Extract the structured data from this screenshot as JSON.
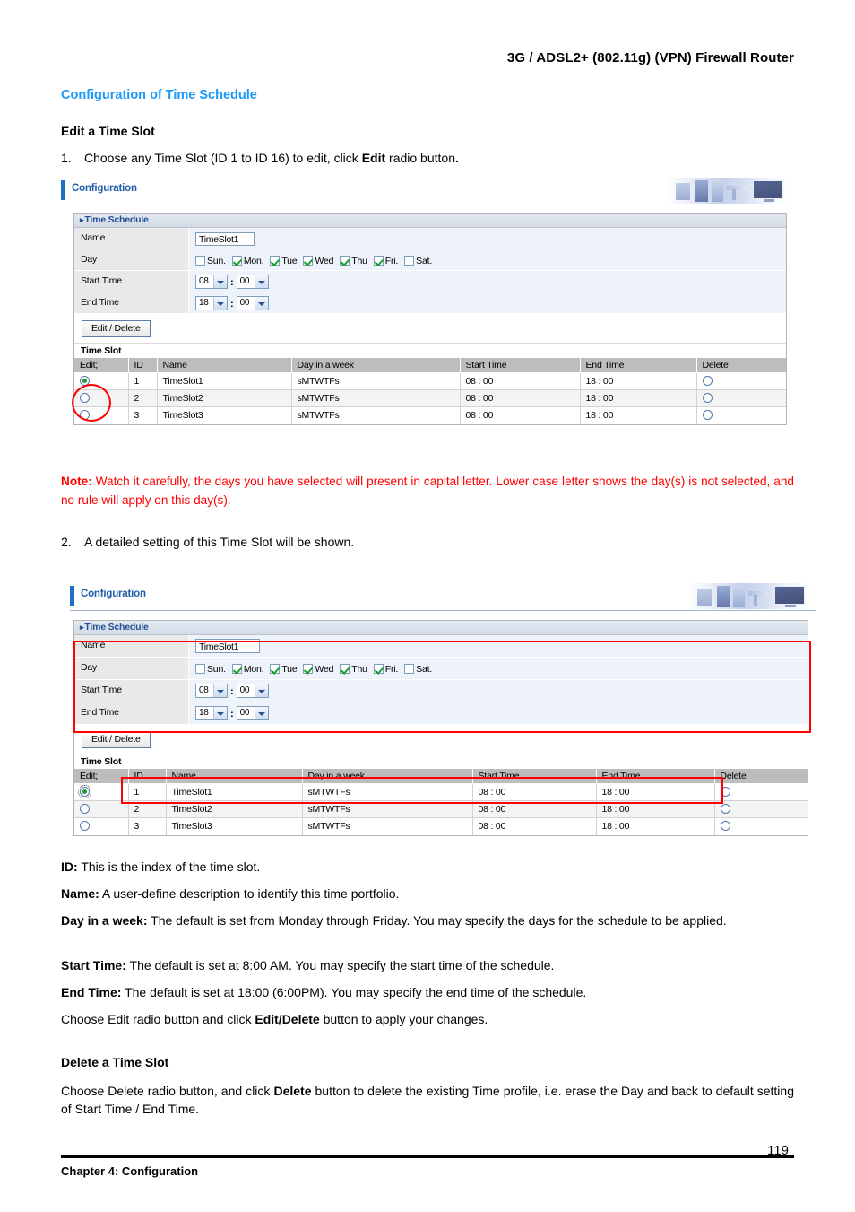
{
  "document": {
    "header_title": "3G / ADSL2+ (802.11g) (VPN) Firewall Router",
    "section_title": "Configuration of Time Schedule",
    "heading_edit": "Edit a Time Slot",
    "heading_delete": "Delete a Time Slot",
    "step1_number": "1.",
    "step1_text_a": "Choose any Time Slot (ID 1 to ID 16) to edit, click ",
    "step1_bold": "Edit",
    "step1_text_b": " radio button",
    "step1_text_c": ".",
    "step2_number": "2.",
    "step2_text": "A detailed setting of this Time Slot will be shown.",
    "note_label": "Note:",
    "note_text": "  Watch it carefully, the days you have selected will present in capital letter.   Lower case letter shows the day(s) is not selected, and no rule will apply on this day(s).",
    "defs": [
      {
        "term": "ID:",
        "gap": "   ",
        "text": "This is the index of the time slot."
      },
      {
        "term": "Name:",
        "gap": " ",
        "text": "A user-define description to identify this time portfolio."
      },
      {
        "term": "Day in a week:",
        "gap": " ",
        "text": "The default is set from Monday through Friday.   You may specify the days for the schedule to be applied."
      },
      {
        "term": "Start Time:",
        "gap": " ",
        "text": "The default is set at 8:00 AM.   You may specify the start time of the schedule."
      },
      {
        "term": "End Time:",
        "gap": " ",
        "text": "The default is set at 18:00 (6:00PM).   You may specify the end time of the schedule."
      }
    ],
    "apply_text_a": "Choose Edit radio button and click ",
    "apply_bold": "Edit/Delete",
    "apply_text_b": " button to apply your changes.",
    "delete_text_a": "Choose Delete radio button, and click ",
    "delete_bold": "Delete",
    "delete_text_b": " button to delete the existing Time profile, i.e. erase the Day and back to default setting of Start Time / End Time.",
    "footer_left": "Chapter 4: Configuration",
    "page_number": "119"
  },
  "colors": {
    "section_title": "#1B9AF7",
    "note": "#FF0000",
    "annotation": "#FF0000",
    "ui_header_accent": "#1F6FC4",
    "panel_title_text": "#1F4F96",
    "table_header_bg": "#BDBDBD",
    "field_label_bg": "#E9E9E9",
    "field_value_bg": "#EEF3FB"
  },
  "screenshot": {
    "window_title": "Configuration",
    "panel_title": "Time Schedule",
    "fields": {
      "name_label": "Name",
      "name_value": "TimeSlot1",
      "day_label": "Day",
      "start_label": "Start Time",
      "end_label": "End Time",
      "start_hour": "08",
      "start_minute": "00",
      "end_hour": "18",
      "end_minute": "00",
      "time_separator": ":"
    },
    "days": [
      {
        "label": "Sun.",
        "checked": false
      },
      {
        "label": "Mon.",
        "checked": true
      },
      {
        "label": "Tue",
        "checked": true
      },
      {
        "label": "Wed",
        "checked": true
      },
      {
        "label": "Thu",
        "checked": true
      },
      {
        "label": "Fri.",
        "checked": true
      },
      {
        "label": "Sat.",
        "checked": false
      }
    ],
    "button_label": "Edit / Delete",
    "table_caption": "Time Slot",
    "columns": [
      "Edit;",
      "ID",
      "Name",
      "Day in a week",
      "Start Time",
      "End Time",
      "Delete"
    ],
    "rows": [
      {
        "edit": true,
        "id": "1",
        "name": "TimeSlot1",
        "days": "sMTWTFs",
        "start": "08 : 00",
        "end": "18 : 00",
        "delete": false
      },
      {
        "edit": false,
        "id": "2",
        "name": "TimeSlot2",
        "days": "sMTWTFs",
        "start": "08 : 00",
        "end": "18 : 00",
        "delete": false
      },
      {
        "edit": false,
        "id": "3",
        "name": "TimeSlot3",
        "days": "sMTWTFs",
        "start": "08 : 00",
        "end": "18 : 00",
        "delete": false
      }
    ]
  }
}
